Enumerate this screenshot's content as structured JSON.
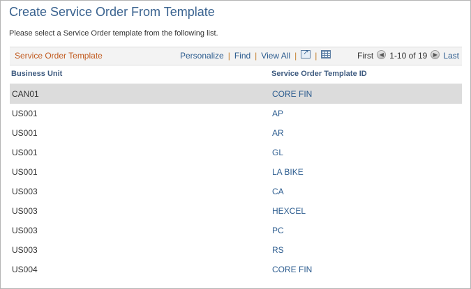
{
  "page": {
    "title": "Create Service Order From Template",
    "instruction": "Please select a Service Order template from the following list."
  },
  "grid": {
    "title": "Service Order Template",
    "tools": {
      "personalize": "Personalize",
      "separator": "|",
      "find": "Find",
      "view_all": "View All",
      "popout_icon": "popout-icon",
      "download_icon": "grid-download-icon"
    },
    "pager": {
      "first": "First",
      "range": "1-10 of 19",
      "last": "Last",
      "prev_icon": "previous-arrow-icon",
      "next_icon": "next-arrow-icon"
    },
    "columns": {
      "business_unit": "Business Unit",
      "template_id": "Service Order Template ID"
    },
    "rows": [
      {
        "bu": "CAN01",
        "tpl": "CORE FIN"
      },
      {
        "bu": "US001",
        "tpl": "AP"
      },
      {
        "bu": "US001",
        "tpl": "AR"
      },
      {
        "bu": "US001",
        "tpl": "GL"
      },
      {
        "bu": "US001",
        "tpl": "LA BIKE"
      },
      {
        "bu": "US003",
        "tpl": "CA"
      },
      {
        "bu": "US003",
        "tpl": "HEXCEL"
      },
      {
        "bu": "US003",
        "tpl": "PC"
      },
      {
        "bu": "US003",
        "tpl": "RS"
      },
      {
        "bu": "US004",
        "tpl": "CORE FIN"
      }
    ],
    "selected_row": 0
  },
  "colors": {
    "title_blue": "#39628f",
    "link_blue": "#2c5c8f",
    "grid_title_orange": "#c15a1f",
    "selected_row_bg": "#dcdcdc"
  }
}
